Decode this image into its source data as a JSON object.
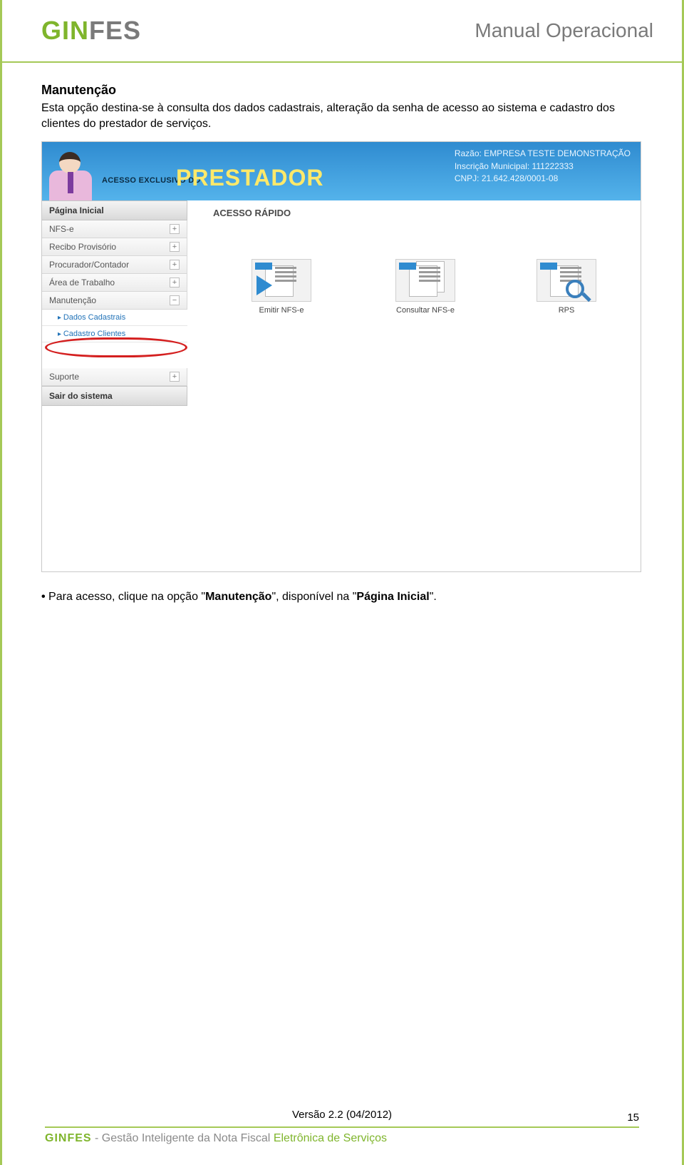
{
  "header": {
    "logo_part1": "GIN",
    "logo_part2": "FES",
    "doc_title": "Manual Operacional"
  },
  "section": {
    "title": "Manutenção",
    "description": "Esta opção destina-se à consulta dos dados cadastrais, alteração da senha de acesso ao sistema e cadastro dos clientes do prestador de serviços."
  },
  "screenshot": {
    "banner": {
      "access_text": "ACESSO EXCLUSIVO DO",
      "role": "PRESTADOR",
      "corp_line1": "Razão: EMPRESA TESTE DEMONSTRAÇÃO",
      "corp_line2": "Inscrição Municipal: 111222333",
      "corp_line3": "CNPJ: 21.642.428/0001-08"
    },
    "acesso_rapido": "ACESSO RÁPIDO",
    "menu": {
      "head": "Página Inicial",
      "items": [
        {
          "label": "NFS-e",
          "sign": "+"
        },
        {
          "label": "Recibo Provisório",
          "sign": "+"
        },
        {
          "label": "Procurador/Contador",
          "sign": "+"
        },
        {
          "label": "Área de Trabalho",
          "sign": "+"
        },
        {
          "label": "Manutenção",
          "sign": "−"
        }
      ],
      "subs": [
        {
          "label": "Dados Cadastrais"
        },
        {
          "label": "Cadastro Clientes"
        }
      ],
      "support": "Suporte",
      "support_sign": "+",
      "logout": "Sair do sistema"
    },
    "qa": [
      {
        "label": "Emitir NFS-e"
      },
      {
        "label": "Consultar NFS-e"
      },
      {
        "label": "RPS"
      }
    ]
  },
  "bullet": {
    "prefix": "Para acesso, clique na opção \"",
    "bold1": "Manutenção",
    "mid": "\", disponível na \"",
    "bold2": "Página Inicial",
    "suffix": "\"."
  },
  "footer": {
    "version": "Versão 2.2 (04/2012)",
    "page": "15",
    "brand1": "GINFES",
    "brand_dash": " - ",
    "brand2": "Gestão Inteligente da Nota Fiscal ",
    "brand3": "Eletrônica de Serviços"
  }
}
